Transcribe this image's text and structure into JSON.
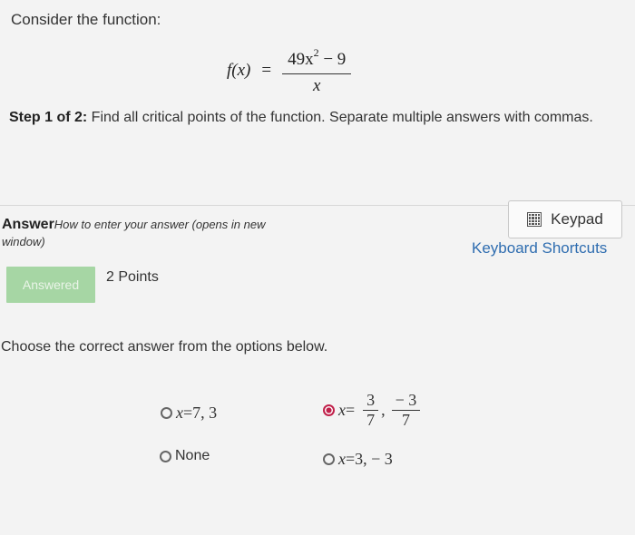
{
  "question": {
    "prompt": "Consider the function:",
    "function": {
      "lhs": "f(x)",
      "equals": "=",
      "numerator_base": "49x",
      "numerator_exponent": "2",
      "numerator_tail": " − 9",
      "denominator": "x"
    },
    "step_label": "Step 1 of 2:",
    "step_text": " Find all critical points of the function. Separate multiple answers with commas."
  },
  "answer": {
    "label": "Answer",
    "help_link": "How to enter your answer (opens in new window)",
    "keypad_label": "Keypad",
    "shortcuts_label": "Keyboard Shortcuts",
    "status_label": "Answered",
    "points": "2 Points",
    "instruction": "Choose the correct answer from the options below."
  },
  "options": {
    "a": {
      "var": "x",
      "eq": " = ",
      "value": "7, 3",
      "selected": false
    },
    "b": {
      "var": "x",
      "eq": " = ",
      "frac1_num": "3",
      "frac1_den": "7",
      "comma": ",",
      "frac2_num": "− 3",
      "frac2_den": "7",
      "selected": true
    },
    "c": {
      "label": "None",
      "selected": false
    },
    "d": {
      "var": "x",
      "eq": " = ",
      "value": "3, − 3",
      "selected": false
    }
  },
  "colors": {
    "link": "#2f6db0",
    "answered_badge": "#a6d6a4",
    "selected_radio": "#c0204a",
    "background": "#f3f3f3"
  },
  "icons": {
    "keypad": "calculator-icon"
  }
}
